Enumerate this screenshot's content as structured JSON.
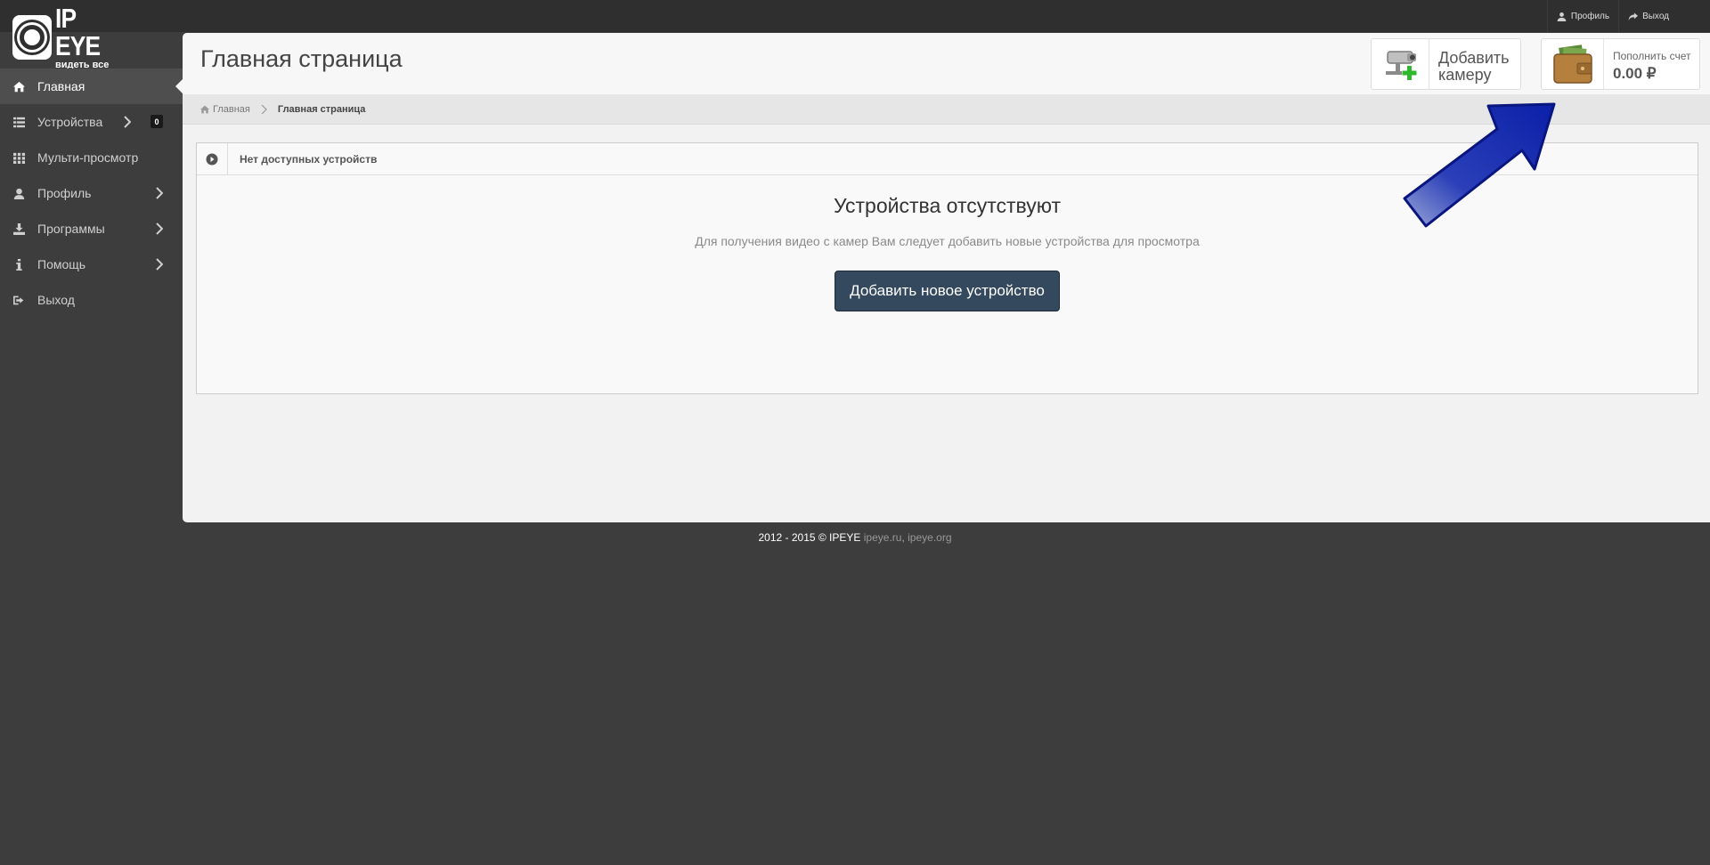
{
  "brand": {
    "logo_text": "IP EYE",
    "tagline": "видеть все"
  },
  "topbar": {
    "profile_label": "Профиль",
    "logout_label": "Выход"
  },
  "sidebar": {
    "items": [
      {
        "label": "Главная",
        "icon": "home-icon",
        "active": true
      },
      {
        "label": "Устройства",
        "icon": "list-icon",
        "badge": "0"
      },
      {
        "label": "Мульти-просмотр",
        "icon": "grid-icon"
      },
      {
        "label": "Профиль",
        "icon": "user-icon"
      },
      {
        "label": "Программы",
        "icon": "download-icon"
      },
      {
        "label": "Помощь",
        "icon": "info-icon"
      },
      {
        "label": "Выход",
        "icon": "logout-icon"
      }
    ]
  },
  "header": {
    "title": "Главная страница",
    "add_camera_line1": "Добавить",
    "add_camera_line2": "камеру",
    "wallet_label": "Пополнить счет",
    "wallet_amount": "0.00 ₽"
  },
  "breadcrumb": {
    "home": "Главная",
    "current": "Главная страница"
  },
  "panel": {
    "title": "Нет доступных устройств",
    "empty_title": "Устройства отсутствуют",
    "empty_desc": "Для получения видео с камер Вам следует добавить новые устройства для просмотра",
    "add_button": "Добавить новое устройство"
  },
  "footer": {
    "copyright": "2012 - 2015 © IPEYE",
    "link1": "ipeye.ru",
    "separator": ",",
    "link2": "ipeye.org"
  },
  "colors": {
    "sidebar_bg": "#3d3d3d",
    "button_primary": "#34495e",
    "annotation_arrow": "#0b1fa8"
  }
}
